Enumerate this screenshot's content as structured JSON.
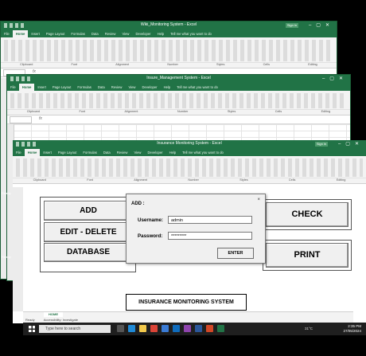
{
  "windows": [
    {
      "title": "Wiki_Monitoring System - Excel",
      "tabs": [
        "File",
        "Home",
        "Insert",
        "Page Layout",
        "Formulas",
        "Data",
        "Review",
        "View",
        "Developer",
        "Help",
        "Tell me what you want to do"
      ],
      "active_tab": "Home",
      "sign_in": "Sign in",
      "ribbon_groups": [
        "Clipboard",
        "Font",
        "Alignment",
        "Number",
        "Styles",
        "Cells",
        "Editing"
      ]
    },
    {
      "title": "Insure_Management System - Excel",
      "tabs": [
        "File",
        "Home",
        "Insert",
        "Page Layout",
        "Formulas",
        "Data",
        "Review",
        "View",
        "Developer",
        "Help",
        "Tell me what you want to do"
      ],
      "active_tab": "Home",
      "sign_in": "",
      "ribbon_groups": [
        "Clipboard",
        "Font",
        "Alignment",
        "Number",
        "Styles",
        "Cells",
        "Editing"
      ]
    },
    {
      "title": "Insurance Monitoring System - Excel",
      "tabs": [
        "File",
        "Home",
        "Insert",
        "Page Layout",
        "Formulas",
        "Data",
        "Review",
        "View",
        "Developer",
        "Help",
        "Tell me what you want to do"
      ],
      "active_tab": "Home",
      "sign_in": "Sign in",
      "ribbon_groups": [
        "Clipboard",
        "Font",
        "Alignment",
        "Number",
        "Styles",
        "Cells",
        "Editing"
      ]
    }
  ],
  "main": {
    "buttons": {
      "add": "ADD",
      "edit_delete": "EDIT - DELETE",
      "database": "DATABASE",
      "check": "CHECK",
      "print": "PRINT"
    },
    "footer_title": "INSURANCE MONITORING SYSTEM",
    "sheet_tab": "HOME"
  },
  "dialog": {
    "title": "ADD :",
    "close": "×",
    "username_label": "Username:",
    "username_value": "admin",
    "password_label": "Password:",
    "password_value": "*********",
    "enter_label": "ENTER"
  },
  "status": {
    "ready": "Ready",
    "accessibility": "Accessibility: Investigate"
  },
  "taskbar": {
    "search_placeholder": "Type here to search",
    "weather": "31°C",
    "time": "2:35 PM",
    "date": "27/05/2024"
  },
  "side": {
    "rows_label": "Ready",
    "cells_label": "Ready"
  },
  "colors": {
    "excel_green": "#217346",
    "taskbar": "#1f1f1f"
  }
}
